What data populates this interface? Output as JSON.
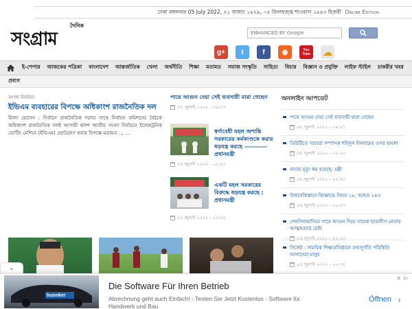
{
  "topbar": {
    "date": "ঢাকা মঙ্গলবার 05 July 2022, ২১ আষাঢ় ১৪২৯, ০৫ জিলহজ্জ্ব শাওয়াল ১৪৪৩ হিজরী",
    "online_edition": "Online Edition"
  },
  "logo": {
    "main": "সংগ্রাম",
    "small": "দৈনিক"
  },
  "search": {
    "placeholder": "ENHANCED BY Google"
  },
  "social": [
    {
      "icon": "google-plus-icon",
      "glyph": "g+",
      "color": "#d34836"
    },
    {
      "icon": "twitter-icon",
      "glyph": "t",
      "color": "#55acee"
    },
    {
      "icon": "facebook-icon",
      "glyph": "f",
      "color": "#3b5998"
    },
    {
      "icon": "rss-icon",
      "glyph": "◉",
      "color": "#f26522"
    },
    {
      "icon": "youtube-icon",
      "glyph": "You Tube",
      "color": "#cc181e"
    },
    {
      "icon": "weather-icon",
      "glyph": "☁",
      "color": "#e8e8e8"
    }
  ],
  "nav": {
    "items": [
      "ই-পেপার",
      "আজকের পত্রিকা",
      "বাংলাদেশ",
      "আন্তর্জাতিক",
      "খেলা",
      "অর্থনীতি",
      "শিক্ষা",
      "মতামত",
      "সমাজ সংস্কৃতি",
      "সাহিত্য",
      "বিচার",
      "বিজ্ঞান ও প্রযুক্তি",
      "লাইফ স্টাইল",
      "চাকরীর খবর"
    ],
    "second_row": "প্রবাস"
  },
  "lead": {
    "kicker": "সংসদ নির্বাচন",
    "title": "ইভিএম ব্যবহারের বিপক্ষে অধিকাংশ রাজনৈতিক দল",
    "body": "মিজা হোসেন : নির্বাচন রাজনৈতিক দলের সাথে নির্বাচন কমিশনের বৈঠকে অধিকাংশ রাজনৈতিক দলই আগামী দ্বাদশ জাতীয় সংসদ নির্বাচনে ইলেকট্রনিক ভোটিং মেশিনে (ইভিএম) ভোটগ্রহণ করার বিপক্ষে মতামত ... ..."
  },
  "middle": {
    "top": {
      "title": "পায়ে আগুন দেয়া সেই ব্যবসায়ী মারা গেছেন",
      "date": "০৫ জুলাই ২০২২ - ০৯:২৭"
    },
    "items": [
      {
        "title": "স্বর্ণাবেধী মহল অশান্তি সরকারের কর্মকাণ্ডকে করার ষড়যন্ত্র করছে ---------- প্রধানমন্ত্রী",
        "date": "০৪ জুলাই ২০২২ - ২২:৪০"
      },
      {
        "title": "একটি মহল সরকারের বিরুদ্ধে ষড়যন্ত্র করছে : প্রধানমন্ত্রী",
        "date": "০৪ জুলাই ২০২২ - ২০:২০"
      }
    ]
  },
  "right": {
    "heading": "অনলাইন আপডেট",
    "items": [
      {
        "title": "পায়ে আগুন দেয়া সেই ব্যবসায়ী মারা গেছেন",
        "date": "০৫ জুলাই ২০২২ - ০৯:২৭"
      },
      {
        "title": "ডিউটিতে সাবেরা সম্পাদক শহিদুল ইসলামের ওপর হামলা",
        "date": "০৫ জুলাই ২০২২ - ২০:২৩"
      },
      {
        "title": "বন্যায় মৃত্যু কম হয়েছে: মন্ত্রী",
        "date": "০৪ জুলাই ২০২২ - ২২:৫০"
      },
      {
        "title": "উজবেকিস্তানে বিক্ষোভে নিহত ১৮, আহত ২৪৩",
        "date": "০৪ জুলাই ২০২২ - ২২:০৭"
      },
      {
        "title": "পেনসিলভানিয়ে পারে আগুন দিয়ে সাবেক ছাত্রলীগ নেতার আত্মহত্যার চেষ্টা",
        "date": "০৪ জুলাই ২০২২ - ২১:২৩"
      },
      {
        "title": "সিলেট : সাময়িক শিক্ষাপ্রতিষ্ঠানে বন্যাদুর্গতি পরিস্থিতি আসাদেরা মানুষ",
        "date": "০৪ জুলাই ২০২২ - ২২:৩৪"
      }
    ]
  },
  "ad": {
    "title": "Die Software Für Ihren Betrieb",
    "description": "Abrechnung geht auch Einfach! - Testen Sie Jetzt Kostenlos - Software für Handwerk und Bau",
    "cta": "Öffnen",
    "brand": "huonker"
  }
}
